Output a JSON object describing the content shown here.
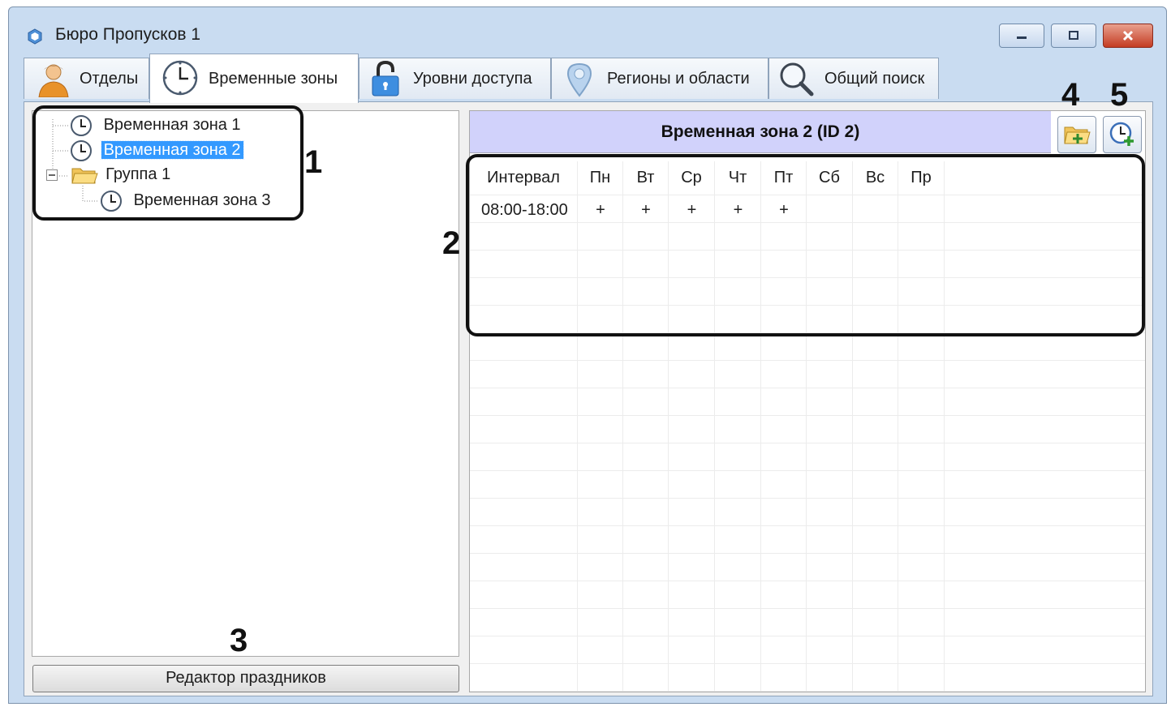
{
  "window": {
    "title": "Бюро Пропусков 1"
  },
  "tabs": [
    {
      "label": "Отделы",
      "icon": "person-icon"
    },
    {
      "label": "Временные зоны",
      "icon": "clock-icon",
      "active": true
    },
    {
      "label": "Уровни доступа",
      "icon": "padlock-icon"
    },
    {
      "label": "Регионы и области",
      "icon": "map-pin-icon"
    },
    {
      "label": "Общий поиск",
      "icon": "magnifier-icon"
    }
  ],
  "tree": {
    "items": [
      {
        "label": "Временная зона 1",
        "icon": "clock-icon"
      },
      {
        "label": "Временная зона 2",
        "icon": "clock-icon",
        "selected": true
      },
      {
        "label": "Группа 1",
        "icon": "folder-icon",
        "expanded": true
      },
      {
        "label": "Временная зона 3",
        "icon": "clock-icon"
      }
    ]
  },
  "holiday_button": {
    "label": "Редактор праздников"
  },
  "zone": {
    "header": "Временная зона 2 (ID 2)",
    "columns": [
      "Интервал",
      "Пн",
      "Вт",
      "Ср",
      "Чт",
      "Пт",
      "Сб",
      "Вс",
      "Пр"
    ],
    "rows": [
      [
        "08:00-18:00",
        "+",
        "+",
        "+",
        "+",
        "+",
        "",
        "",
        ""
      ]
    ]
  },
  "callouts": [
    "1",
    "2",
    "3",
    "4",
    "5"
  ],
  "colors": {
    "header_bg": "#d1d2fb",
    "selection": "#3399ff",
    "window_frame": "#c9dcf1",
    "close_button": "#c43c23"
  }
}
